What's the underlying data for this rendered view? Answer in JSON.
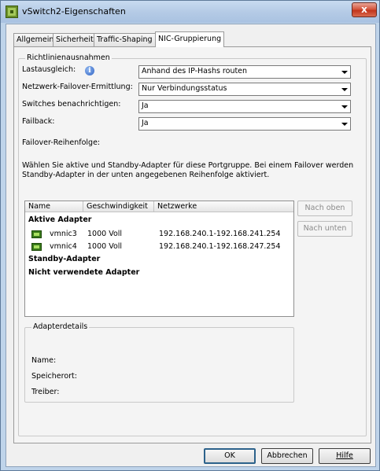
{
  "window": {
    "title": "vSwitch2-Eigenschaften",
    "close_glyph": "x"
  },
  "tabs": [
    {
      "label": "Allgemein",
      "active": false
    },
    {
      "label": "Sicherheit",
      "active": false
    },
    {
      "label": "Traffic-Shaping",
      "active": false
    },
    {
      "label": "NIC-Gruppierung",
      "active": true
    }
  ],
  "policy": {
    "legend": "Richtlinienausnahmen",
    "fields": [
      {
        "label": "Lastausgleich:",
        "value": "Anhand des IP-Hashs routen"
      },
      {
        "label": "Netzwerk-Failover-Ermittlung:",
        "value": "Nur Verbindungsstatus"
      },
      {
        "label": "Switches benachrichtigen:",
        "value": "Ja"
      },
      {
        "label": "Failback:",
        "value": "Ja"
      }
    ],
    "info_icon_glyph": "i",
    "failover_order_label": "Failover-Reihenfolge:",
    "description": "Wählen Sie aktive und Standby-Adapter für diese Portgruppe. Bei einem Failover werden",
    "description_line2": "Standby-Adapter in der unten angegebenen Reihenfolge aktiviert."
  },
  "adapter_table": {
    "columns": [
      "Name",
      "Geschwindigkeit",
      "Netzwerke"
    ],
    "groups": [
      {
        "title": "Aktive Adapter",
        "rows": [
          {
            "name": "vmnic3",
            "speed": "1000 Voll",
            "networks": "192.168.240.1-192.168.241.254"
          },
          {
            "name": "vmnic4",
            "speed": "1000 Voll",
            "networks": "192.168.240.1-192.168.247.254"
          }
        ]
      },
      {
        "title": "Standby-Adapter",
        "rows": []
      },
      {
        "title": "Nicht verwendete Adapter",
        "rows": []
      }
    ]
  },
  "side_buttons": {
    "move_up": "Nach oben",
    "move_down": "Nach unten"
  },
  "details": {
    "legend": "Adapterdetails",
    "fields": [
      "Name:",
      "Speicherort:",
      "Treiber:"
    ]
  },
  "buttons": {
    "ok": "OK",
    "cancel": "Abbrechen",
    "help": "Hilfe"
  },
  "colors": {
    "title_bar": "#b5cbe6",
    "close_button": "#c2351c",
    "client_bg": "#f0f0f0"
  }
}
